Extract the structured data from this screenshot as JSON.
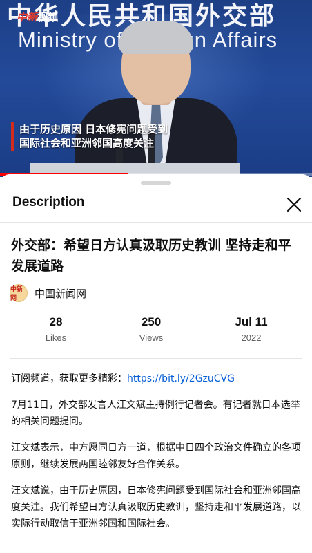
{
  "video": {
    "banner_cn": "中华人民共和国外交部",
    "banner_en": "Ministry of Foreign Affairs",
    "watermark": {
      "brand_red": "中新",
      "brand_white": "视频"
    },
    "subtitle_lines": [
      "由于历史原因 日本修宪问题受到",
      "国际社会和亚洲邻国高度关注"
    ],
    "progress_fraction": 0.41
  },
  "sheet": {
    "title": "Description",
    "video_title": "外交部：希望日方认真汲取历史教训 坚持走和平发展道路",
    "channel": {
      "name": "中国新闻网",
      "avatar_text": "中新网"
    },
    "stats": [
      {
        "value": "28",
        "label": "Likes"
      },
      {
        "value": "250",
        "label": "Views"
      },
      {
        "value": "Jul 11",
        "label": "2022"
      }
    ],
    "description": {
      "subscribe_text": "订阅频道，获取更多精彩：",
      "subscribe_link": "https://bit.ly/2GzuCVG",
      "paragraphs": [
        "7月11日，外交部发言人汪文斌主持例行记者会。有记者就日本选举的相关问题提问。",
        "汪文斌表示，中方愿同日方一道，根据中日四个政治文件确立的各项原则，继续发展两国睦邻友好合作关系。",
        "汪文斌说，由于历史原因，日本修宪问题受到国际社会和亚洲邻国高度关注。我们希望日方认真汲取历史教训，坚持走和平发展道路，以实际行动取信于亚洲邻国和国际社会。"
      ]
    }
  },
  "colors": {
    "accent_red": "#ff0000",
    "link": "#065fd4",
    "video_bg": "#234a99"
  }
}
